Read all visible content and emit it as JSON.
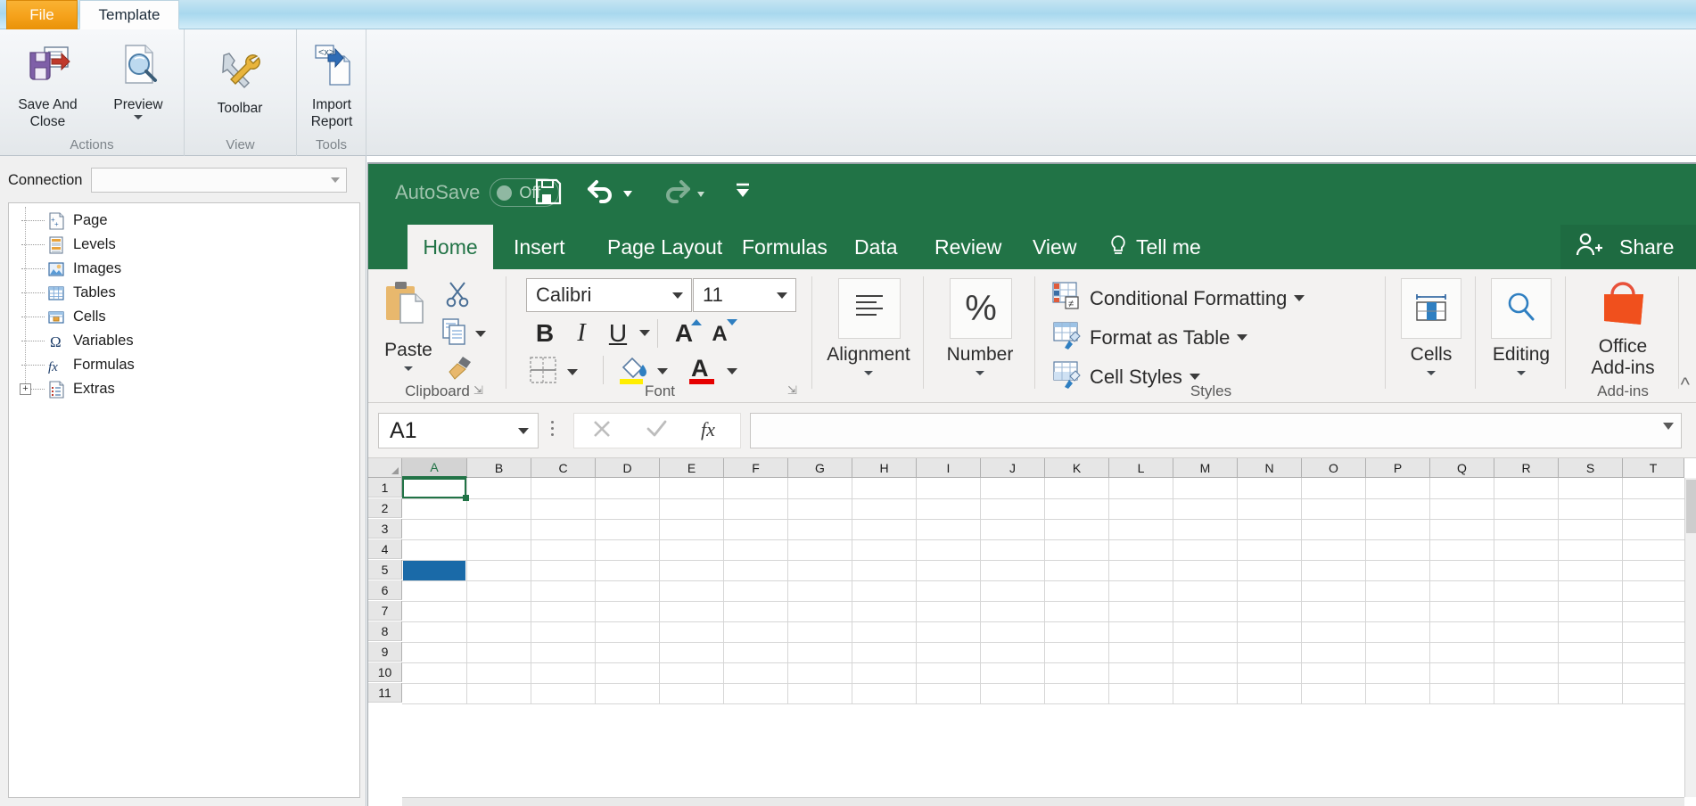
{
  "host": {
    "tabs": [
      {
        "id": "file",
        "label": "File"
      },
      {
        "id": "template",
        "label": "Template"
      }
    ],
    "groups": [
      {
        "id": "actions",
        "label": "Actions",
        "buttons": [
          {
            "id": "save-and-close",
            "label": "Save And\nClose",
            "label_line1": "Save And",
            "label_line2": "Close",
            "icon": "save-export-icon",
            "has_caret": false
          },
          {
            "id": "preview",
            "label": "Preview",
            "icon": "preview-magnifier-icon",
            "has_caret": true
          }
        ]
      },
      {
        "id": "view",
        "label": "View",
        "buttons": [
          {
            "id": "toolbar",
            "label": "Toolbar",
            "icon": "wrench-hammer-icon",
            "has_caret": false
          }
        ]
      },
      {
        "id": "tools",
        "label": "Tools",
        "buttons": [
          {
            "id": "import-report",
            "label_line1": "Import",
            "label_line2": "Report",
            "icon": "import-xml-icon",
            "has_caret": false
          }
        ]
      }
    ]
  },
  "leftpane": {
    "connection": {
      "label": "Connection",
      "value": "",
      "placeholder": ""
    },
    "tree": [
      {
        "label": "Page",
        "icon": "page-add-icon",
        "expandable": false
      },
      {
        "label": "Levels",
        "icon": "levels-icon",
        "expandable": false
      },
      {
        "label": "Images",
        "icon": "images-icon",
        "expandable": false
      },
      {
        "label": "Tables",
        "icon": "tables-icon",
        "expandable": false
      },
      {
        "label": "Cells",
        "icon": "cells-icon",
        "expandable": false
      },
      {
        "label": "Variables",
        "icon": "omega-icon",
        "expandable": false
      },
      {
        "label": "Formulas",
        "icon": "fx-icon",
        "expandable": false
      },
      {
        "label": "Extras",
        "icon": "extras-icon",
        "expandable": true,
        "expander": "+"
      }
    ]
  },
  "excel": {
    "titlebar": {
      "autosave_label": "AutoSave",
      "autosave_state": "Off",
      "quick_access": [
        {
          "id": "save",
          "icon": "floppy-save-icon",
          "caret": false
        },
        {
          "id": "undo",
          "icon": "undo-arrow-icon",
          "caret": true
        },
        {
          "id": "redo",
          "icon": "redo-arrow-icon",
          "caret": true
        },
        {
          "id": "customize-qat",
          "icon": "qat-overflow-icon",
          "caret": false
        }
      ]
    },
    "tabs": [
      {
        "id": "home",
        "label": "Home",
        "active": true
      },
      {
        "id": "insert",
        "label": "Insert",
        "active": false
      },
      {
        "id": "page-layout",
        "label": "Page Layout",
        "active": false
      },
      {
        "id": "formulas",
        "label": "Formulas",
        "active": false
      },
      {
        "id": "data",
        "label": "Data",
        "active": false
      },
      {
        "id": "review",
        "label": "Review",
        "active": false
      },
      {
        "id": "view",
        "label": "View",
        "active": false
      },
      {
        "id": "tell-me",
        "label": "Tell me",
        "active": false,
        "icon": "lightbulb-icon"
      }
    ],
    "share_label": "Share",
    "ribbon": {
      "clipboard": {
        "label": "Clipboard",
        "paste_label": "Paste",
        "cut_icon": "scissors-icon",
        "copy_icon": "copy-icon",
        "format_painter_icon": "format-painter-icon"
      },
      "font": {
        "label": "Font",
        "font_name": "Calibri",
        "font_size": "11",
        "bold": "B",
        "italic": "I",
        "underline": "U",
        "grow_font": "A",
        "shrink_font": "A",
        "borders_icon": "borders-icon",
        "fill_color_icon": "fill-color-icon",
        "font_color_icon": "font-color-icon"
      },
      "alignment": {
        "label": "Alignment",
        "icon": "align-lines-icon"
      },
      "number": {
        "label": "Number",
        "icon": "percent-icon",
        "symbol": "%"
      },
      "styles": {
        "label": "Styles",
        "items": [
          {
            "id": "conditional-formatting",
            "label": "Conditional Formatting",
            "icon": "conditional-formatting-icon"
          },
          {
            "id": "format-as-table",
            "label": "Format as Table",
            "icon": "format-as-table-icon"
          },
          {
            "id": "cell-styles",
            "label": "Cell Styles",
            "icon": "cell-styles-icon"
          }
        ]
      },
      "cells": {
        "label": "Cells",
        "icon": "cells-width-icon"
      },
      "editing": {
        "label": "Editing",
        "icon": "find-magnifier-icon"
      },
      "addins": {
        "label": "Add-ins",
        "button_line1": "Office",
        "button_line2": "Add-ins",
        "icon": "office-store-bag-icon"
      }
    },
    "formula_bar": {
      "name_box": "A1",
      "cancel_icon": "cancel-x-icon",
      "enter_icon": "enter-check-icon",
      "insert_function_icon": "fx-icon",
      "value": ""
    },
    "grid": {
      "columns": [
        "A",
        "B",
        "C",
        "D",
        "E",
        "F",
        "G",
        "H",
        "I",
        "J",
        "K",
        "L",
        "M",
        "N",
        "O",
        "P",
        "Q",
        "R",
        "S",
        "T"
      ],
      "rows": [
        "1",
        "2",
        "3",
        "4",
        "5",
        "6",
        "7",
        "8",
        "9",
        "10",
        "11"
      ],
      "selected_cell": "A1",
      "selected_column": "A",
      "filled_cells": [
        {
          "cell": "A5",
          "color": "#1a6aa8"
        }
      ]
    }
  },
  "colors": {
    "excel_green": "#217346",
    "excel_dark_green": "#1e6b41",
    "ribbon_bg": "#f3f2f1",
    "file_tab_orange": "#f5a11a",
    "host_tabstrip_blue": "#a8d8ee",
    "fill_blue": "#1a6aa8"
  }
}
